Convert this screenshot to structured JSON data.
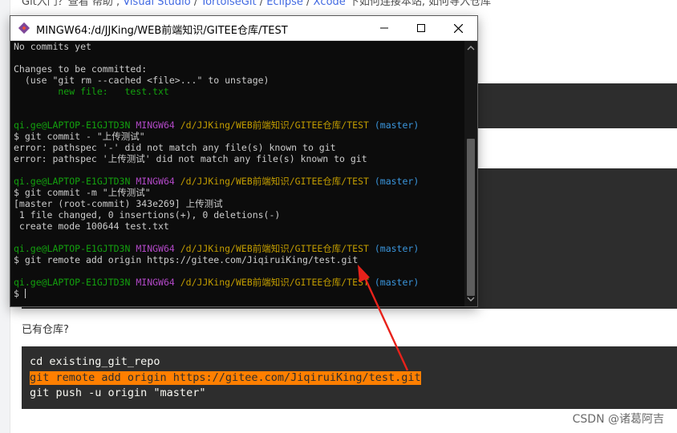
{
  "page": {
    "top_text_prefix": "Git入门？查看 帮助 ,",
    "top_links": [
      "Visual Studio",
      "TortoiseGit",
      "Eclipse",
      "Xcode"
    ],
    "top_text_suffix": "下如何连接本站, 如何导入仓库",
    "have_repo_label": "已有仓库?",
    "code_lines": [
      "cd existing_git_repo",
      "git remote add origin https://gitee.com/JiqiruiKing/test.git",
      "git push -u origin \"master\""
    ],
    "highlighted_line": 1,
    "highlight_color": "#ff7f00",
    "watermark": "CSDN @诸葛阿吉"
  },
  "terminal": {
    "title": "MINGW64:/d/JJKing/WEB前端知识/GITEE仓库/TEST",
    "buttons": {
      "minimize": "minimize",
      "maximize": "maximize",
      "close": "close"
    },
    "prompt": {
      "user": "qi.ge@LAPTOP-E1GJTD3N",
      "shell": "MINGW64",
      "path": "/d/JJKing/WEB前端知识/GITEE仓库/TEST",
      "branch": "(master)"
    },
    "lines": {
      "l1": "No commits yet",
      "l3": "Changes to be committed:",
      "l4": "  (use \"git rm --cached <file>...\" to unstage)",
      "l5": "        new file:   test.txt",
      "l9": "$ git commit - \"上传测试\"",
      "l10": "error: pathspec '-' did not match any file(s) known to git",
      "l11": "error: pathspec '上传测试' did not match any file(s) known to git",
      "l14": "$ git commit -m \"上传测试\"",
      "l15": "[master (root-commit) 343e269] 上传测试",
      "l16": " 1 file changed, 0 insertions(+), 0 deletions(-)",
      "l17": " create mode 100644 test.txt",
      "l20": "$ git remote add origin https://gitee.com/JiqiruiKing/test.git",
      "l23": "$ "
    },
    "colors": {
      "background": "#0c0c0c",
      "green": "#13a10e",
      "magenta": "#b148c6",
      "yellow": "#c19c00",
      "cyan": "#3a96dd"
    }
  },
  "annotation": {
    "arrow_color": "#e8221b"
  }
}
